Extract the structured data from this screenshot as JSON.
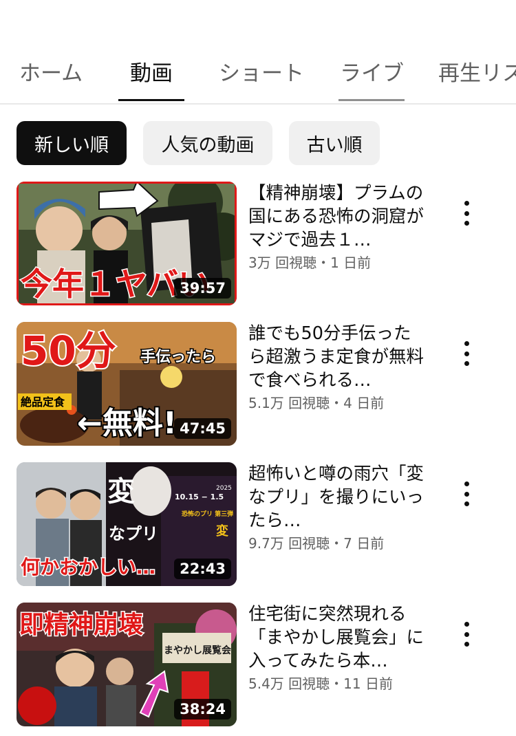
{
  "tabs": [
    {
      "label": "ホーム",
      "active": false
    },
    {
      "label": "動画",
      "active": true
    },
    {
      "label": "ショート",
      "active": false
    },
    {
      "label": "ライブ",
      "active": false
    },
    {
      "label": "再生リスト",
      "active": false
    }
  ],
  "filters": [
    {
      "label": "新しい順",
      "selected": true
    },
    {
      "label": "人気の動画",
      "selected": false
    },
    {
      "label": "古い順",
      "selected": false
    }
  ],
  "videos": [
    {
      "title": "【精神崩壊】プラムの国にある恐怖の洞窟がマジで過去１…",
      "views": "3万 回視聴",
      "age": "1 日前",
      "duration": "39:57",
      "thumb_caption": "今年１ヤバい"
    },
    {
      "title": "誰でも50分手伝ったら超激うま定食が無料で食べられる…",
      "views": "5.1万 回視聴",
      "age": "4 日前",
      "duration": "47:45",
      "thumb_caption_top": "50分",
      "thumb_caption_mid": "手伝ったら",
      "thumb_caption_tag": "絶品定食",
      "thumb_caption_bottom": "←無料!"
    },
    {
      "title": "超怖いと噂の雨穴「変なプリ」を撮りにいったら…",
      "views": "9.7万 回視聴",
      "age": "7 日前",
      "duration": "22:43",
      "thumb_caption_big": "変",
      "thumb_caption_sub": "なプリ",
      "thumb_caption_bottom": "何かおかしい…",
      "thumb_poster_date": "10.15 − 1.5",
      "thumb_poster_year": "2025",
      "thumb_poster_title": "恐怖のプリ 第三弾",
      "thumb_poster_title_big": "変"
    },
    {
      "title": "住宅街に突然現れる「まやかし展覧会」に入ってみたら本…",
      "views": "5.4万 回視聴",
      "age": "11 日前",
      "duration": "38:24",
      "thumb_caption_top": "即精神崩壊",
      "thumb_sign": "まやかし展覧会"
    }
  ],
  "meta_separator": "・",
  "colors": {
    "text_primary": "#0f0f0f",
    "text_secondary": "#606060",
    "chip_bg": "#f0f0f0",
    "chip_selected_bg": "#0f0f0f",
    "thumb_red": "#e01818"
  }
}
